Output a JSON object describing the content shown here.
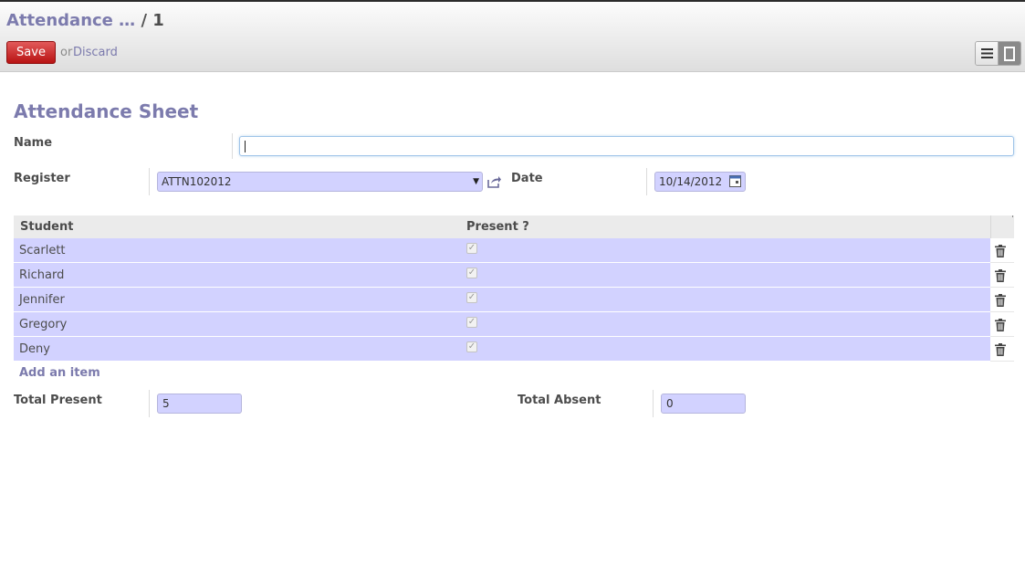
{
  "header": {
    "breadcrumb_parent": "Attendance …",
    "breadcrumb_sep": "/",
    "breadcrumb_current": "1",
    "save_label": "Save",
    "or_text": "or",
    "discard_label": "Discard"
  },
  "view_switcher": [
    "list-view-icon",
    "form-view-icon"
  ],
  "form": {
    "title": "Attendance Sheet",
    "name_label": "Name",
    "name_value": "",
    "register_label": "Register",
    "register_value": "ATTN102012",
    "date_label": "Date",
    "date_value": "10/14/2012"
  },
  "table": {
    "headers": [
      "Student",
      "Present ?"
    ],
    "rows": [
      {
        "student": "Scarlett",
        "present": true
      },
      {
        "student": "Richard",
        "present": true
      },
      {
        "student": "Jennifer",
        "present": true
      },
      {
        "student": "Gregory",
        "present": true
      },
      {
        "student": "Deny",
        "present": true
      }
    ],
    "add_item_label": "Add an item"
  },
  "totals": {
    "present_label": "Total Present",
    "present_value": "5",
    "absent_label": "Total Absent",
    "absent_value": "0"
  },
  "colors": {
    "accent": "#7c7bad",
    "save_button": "#c41a1a",
    "readonly_field": "#d2d2ff"
  }
}
